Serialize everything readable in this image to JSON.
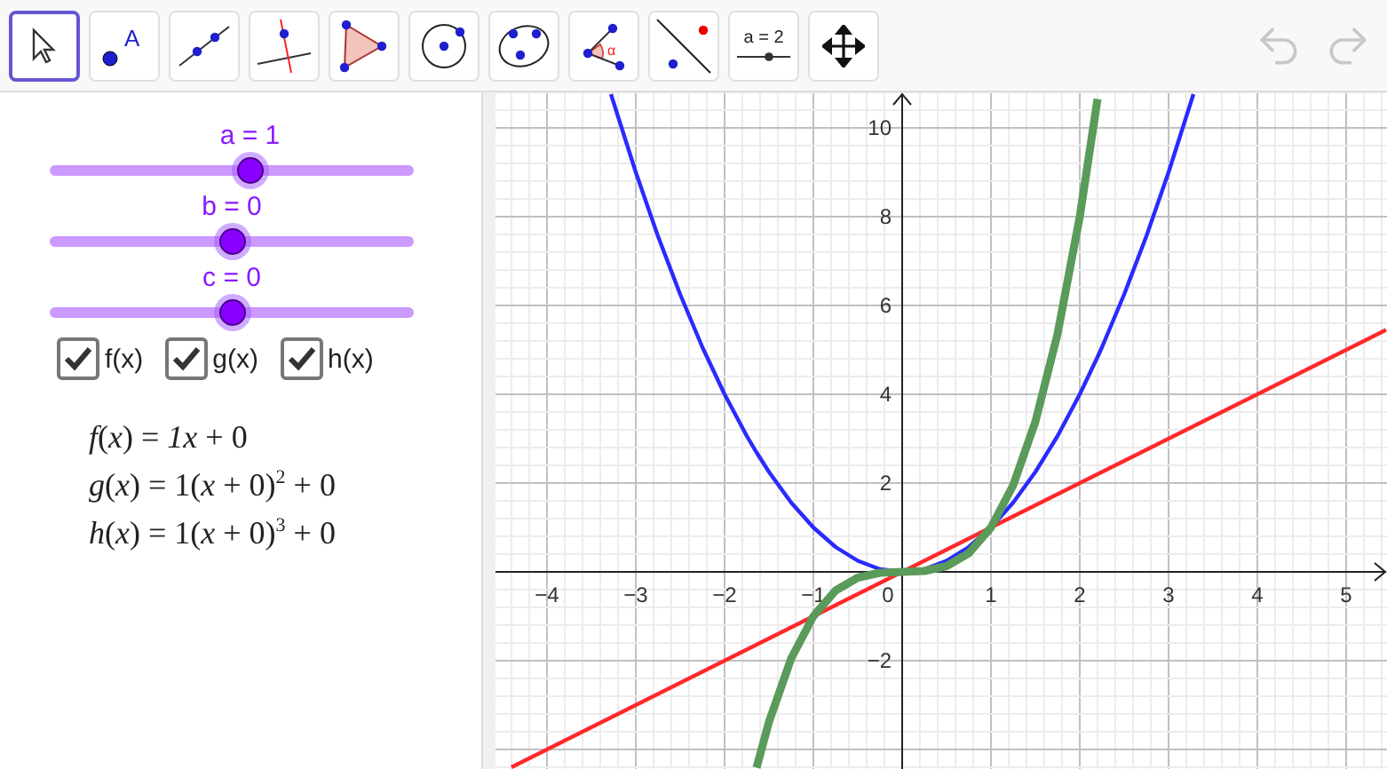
{
  "toolbar": {
    "tools": [
      {
        "kind": "move",
        "selected": true
      },
      {
        "kind": "point",
        "label": "A",
        "selected": false
      },
      {
        "kind": "line",
        "selected": false
      },
      {
        "kind": "perpendicular",
        "selected": false
      },
      {
        "kind": "polygon",
        "selected": false
      },
      {
        "kind": "circle",
        "selected": false
      },
      {
        "kind": "conic",
        "selected": false
      },
      {
        "kind": "angle",
        "label": "α",
        "selected": false
      },
      {
        "kind": "reflect",
        "selected": false
      },
      {
        "kind": "slider",
        "label": "a = 2",
        "selected": false
      },
      {
        "kind": "pan",
        "selected": false
      }
    ],
    "undo": {
      "disabled": true
    },
    "redo": {
      "disabled": true
    }
  },
  "sliders": [
    {
      "label": "a = 1",
      "level": 0.55
    },
    {
      "label": "b = 0",
      "level": 0.5
    },
    {
      "label": "c = 0",
      "level": 0.5
    }
  ],
  "checkboxes": [
    {
      "label": "f(x)",
      "checked": true
    },
    {
      "label": "g(x)",
      "checked": true
    },
    {
      "label": "h(x)",
      "checked": true
    }
  ],
  "formulas": [
    "*f*(*x*) = *1x* + 0",
    "*g*(*x*) = 1(*x* + 0)$^{2}$ + 0",
    "*h*(*x*) = 1(*x* + 0)$^{3}$ + 0"
  ],
  "graph": {
    "chart_data": {
      "type": "line",
      "x": [
        -4.4,
        -4,
        -3.75,
        -3.5,
        -3.28,
        -3,
        -2.75,
        -2.5,
        -2.25,
        -2,
        -1.75,
        -1.64,
        -1.5,
        -1.25,
        -1,
        -0.75,
        -0.5,
        -0.25,
        0,
        0.25,
        0.5,
        0.75,
        1,
        1.25,
        1.5,
        1.75,
        2,
        2.2,
        2.25,
        2.5,
        2.75,
        3,
        3.28,
        3.5,
        3.75,
        4,
        4.25,
        4.5,
        4.75,
        5,
        5.25,
        5.45
      ],
      "series": [
        {
          "color": "#ff2a2a",
          "values": [
            -4.4,
            -4,
            -3.75,
            -3.5,
            -3.28,
            -3,
            -2.75,
            -2.5,
            -2.25,
            -2,
            -1.75,
            -1.64,
            -1.5,
            -1.25,
            -1,
            -0.75,
            -0.5,
            -0.25,
            0,
            0.25,
            0.5,
            0.75,
            1,
            1.25,
            1.5,
            1.75,
            2,
            2.2,
            2.25,
            2.5,
            2.75,
            3,
            3.28,
            3.5,
            3.75,
            4,
            4.25,
            4.5,
            4.75,
            5,
            5.25,
            5.45
          ]
        },
        {
          "color": "#2a2aff",
          "values": [
            null,
            null,
            null,
            null,
            10.76,
            9,
            7.56,
            6.25,
            5.06,
            4,
            3.06,
            2.69,
            2.25,
            1.56,
            1,
            0.56,
            0.25,
            0.06,
            0,
            0.06,
            0.25,
            0.56,
            1,
            1.56,
            2.25,
            3.06,
            4,
            4.84,
            5.06,
            6.25,
            7.56,
            9,
            10.76,
            null,
            null,
            null,
            null,
            null,
            null,
            null,
            null,
            null
          ]
        },
        {
          "color": "#5a9a5a",
          "values": [
            null,
            null,
            null,
            null,
            null,
            null,
            null,
            null,
            null,
            null,
            null,
            -4.41,
            -3.38,
            -1.95,
            -1,
            -0.42,
            -0.13,
            -0.02,
            0,
            0.02,
            0.13,
            0.42,
            1,
            1.95,
            3.38,
            5.36,
            8,
            10.65,
            null,
            null,
            null,
            null,
            null,
            null,
            null,
            null,
            null,
            null,
            null,
            null,
            null,
            null
          ]
        }
      ],
      "grid": true,
      "xlim": [
        -4.58,
        5.46
      ],
      "ylim": [
        -4.44,
        10.8
      ],
      "xticks": [
        {
          "value": -4,
          "label": "−4"
        },
        {
          "value": -3,
          "label": "−3"
        },
        {
          "value": -2,
          "label": "−2"
        },
        {
          "value": -1,
          "label": "−1"
        },
        1,
        2,
        3,
        4,
        5
      ],
      "yticks": [
        {
          "value": -2,
          "label": "−2"
        },
        2,
        4,
        6,
        8,
        10
      ]
    },
    "origin_label": "0"
  }
}
